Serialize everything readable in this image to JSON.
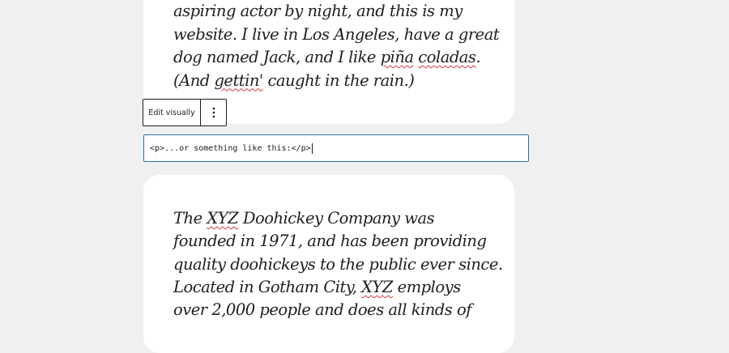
{
  "top_block": {
    "lines": [
      [
        {
          "t": "aspiring actor by night, and this is my"
        }
      ],
      [
        {
          "t": "website. I live in Los Angeles, have a great"
        }
      ],
      [
        {
          "t": "dog named Jack, and I like "
        },
        {
          "t": "piña",
          "spell": true
        },
        {
          "t": " "
        },
        {
          "t": "coladas",
          "spell": true
        },
        {
          "t": "."
        }
      ],
      [
        {
          "t": "(And "
        },
        {
          "t": "gettin'",
          "spell": true
        },
        {
          "t": " caught in the rain.)"
        }
      ]
    ]
  },
  "block_toolbar": {
    "edit_visually_label": "Edit visually",
    "options_icon": "vertical-ellipsis-icon"
  },
  "html_editor": {
    "value": "<p>...or something like this:</p>"
  },
  "bottom_block": {
    "lines": [
      [
        {
          "t": "The "
        },
        {
          "t": "XYZ",
          "spell": true
        },
        {
          "t": " Doohickey Company was"
        }
      ],
      [
        {
          "t": "founded in 1971, and has been providing"
        }
      ],
      [
        {
          "t": "quality doohickeys to the public ever since."
        }
      ],
      [
        {
          "t": "Located in Gotham City, "
        },
        {
          "t": "XYZ",
          "spell": true
        },
        {
          "t": " employs"
        }
      ],
      [
        {
          "t": "over 2,000 people and does all kinds of"
        }
      ]
    ]
  },
  "colors": {
    "accent": "#2271b1",
    "spellcheck": "#d63638",
    "canvas": "#f0f0f1"
  }
}
